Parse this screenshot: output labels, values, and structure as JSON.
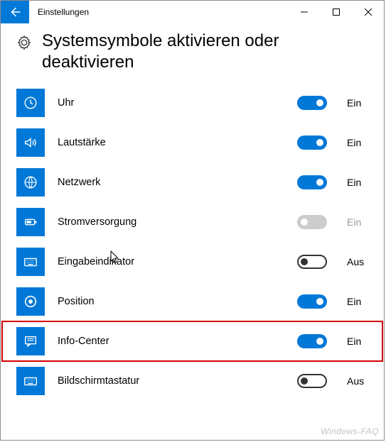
{
  "window": {
    "title": "Einstellungen"
  },
  "page": {
    "heading": "Systemsymbole aktivieren oder deaktivieren"
  },
  "state_labels": {
    "on": "Ein",
    "off": "Aus",
    "disabled": "Ein"
  },
  "items": [
    {
      "id": "clock",
      "label": "Uhr",
      "state": "on",
      "icon": "clock"
    },
    {
      "id": "volume",
      "label": "Lautstärke",
      "state": "on",
      "icon": "volume"
    },
    {
      "id": "network",
      "label": "Netzwerk",
      "state": "on",
      "icon": "network"
    },
    {
      "id": "power",
      "label": "Stromversorgung",
      "state": "disabled",
      "icon": "power"
    },
    {
      "id": "input",
      "label": "Eingabeindikator",
      "state": "off",
      "icon": "keyboard"
    },
    {
      "id": "location",
      "label": "Position",
      "state": "on",
      "icon": "location"
    },
    {
      "id": "action",
      "label": "Info-Center",
      "state": "on",
      "icon": "action",
      "highlight": true
    },
    {
      "id": "osk",
      "label": "Bildschirmtastatur",
      "state": "off",
      "icon": "keyboard"
    }
  ],
  "watermark": "Windows-FAQ"
}
